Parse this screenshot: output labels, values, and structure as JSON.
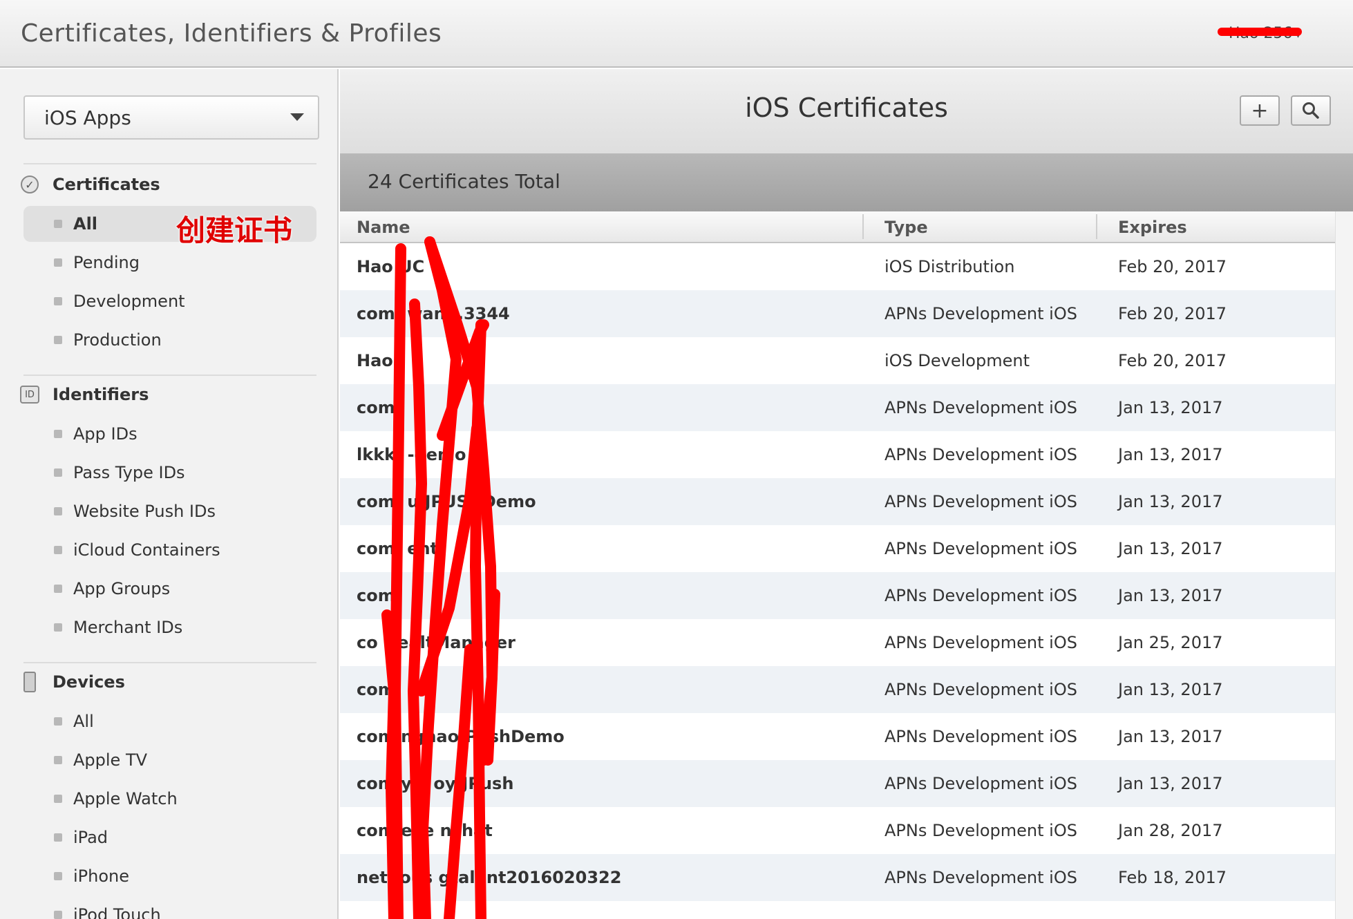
{
  "header": {
    "app_title": "Certificates, Identifiers & Profiles",
    "user_name": "Hao 256"
  },
  "sidebar": {
    "platform_select": "iOS Apps",
    "sections": {
      "certificates": {
        "title": "Certificates",
        "items": [
          "All",
          "Pending",
          "Development",
          "Production"
        ],
        "selected": "All"
      },
      "identifiers": {
        "title": "Identifiers",
        "icon_text": "ID",
        "items": [
          "App IDs",
          "Pass Type IDs",
          "Website Push IDs",
          "iCloud Containers",
          "App Groups",
          "Merchant IDs"
        ]
      },
      "devices": {
        "title": "Devices",
        "items": [
          "All",
          "Apple TV",
          "Apple Watch",
          "iPad",
          "iPhone",
          "iPod Touch"
        ]
      }
    }
  },
  "annotation": {
    "text": "创建证书",
    "color": "#e00000"
  },
  "main": {
    "title": "iOS Certificates",
    "add_button": "+",
    "search_icon": "search-icon",
    "total_text": "24 Certificates Total",
    "columns": [
      "Name",
      "Type",
      "Expires"
    ],
    "rows": [
      {
        "name": "Hao UC",
        "type": "iOS Distribution",
        "expires": "Feb 20, 2017"
      },
      {
        "name": "com.        wang.3344",
        "type": "APNs Development iOS",
        "expires": "Feb 20, 2017"
      },
      {
        "name": "Hao",
        "type": "iOS Development",
        "expires": "Feb 20, 2017"
      },
      {
        "name": "com.",
        "type": "APNs Development iOS",
        "expires": "Jan 13, 2017"
      },
      {
        "name": "lkkk.       -demo",
        "type": "APNs Development iOS",
        "expires": "Jan 13, 2017"
      },
      {
        "name": "com.       uiJPUSHDemo",
        "type": "APNs Development iOS",
        "expires": "Jan 13, 2017"
      },
      {
        "name": "com.        ent",
        "type": "APNs Development iOS",
        "expires": "Jan 13, 2017"
      },
      {
        "name": "com.",
        "type": "APNs Development iOS",
        "expires": "Jan 13, 2017"
      },
      {
        "name": "co          HealtManager",
        "type": "APNs Development iOS",
        "expires": "Jan 25, 2017"
      },
      {
        "name": "com",
        "type": "APNs Development iOS",
        "expires": "Jan 13, 2017"
      },
      {
        "name": "com          nghaoJPushDemo",
        "type": "APNs Development iOS",
        "expires": "Jan 13, 2017"
      },
      {
        "name": "com       y.T    oyJJPush",
        "type": "APNs Development iOS",
        "expires": "Jan 13, 2017"
      },
      {
        "name": "com       eve    nchat",
        "type": "APNs Development iOS",
        "expires": "Jan 28, 2017"
      },
      {
        "name": "net.      ous   gtalent2016020322",
        "type": "APNs Development iOS",
        "expires": "Feb 18, 2017"
      }
    ]
  },
  "colors": {
    "redaction": "#ff0000",
    "row_alt": "#eef2f6"
  }
}
